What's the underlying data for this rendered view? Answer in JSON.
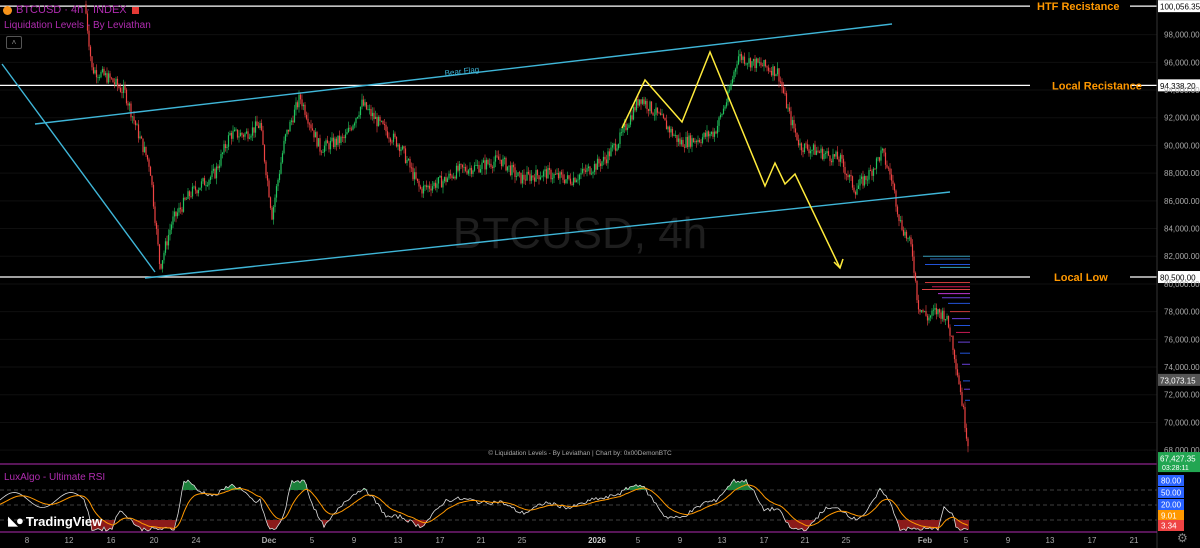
{
  "header": {
    "symbol": "BTCUSD · 4h · INDEX",
    "indicator": "Liquidation Levels - By Leviathan"
  },
  "watermark": "BTCUSD, 4h",
  "footer_credit": "© Liquidation Levels - By Leviathan | Chart by: 0x00DemonBTC",
  "rsi_panel": {
    "title": "LuxAlgo - Ultimate RSI",
    "levels": [
      80,
      50,
      20
    ]
  },
  "branding": "TradingView",
  "colors": {
    "up": "#22c55e",
    "down": "#ef4444",
    "channel": "#3fb6d8",
    "projection": "#ffeb3b",
    "levels": "#ffffff",
    "level_labels": "#ff9800",
    "accent": "#b02cb0"
  },
  "chart_data": {
    "type": "candlestick",
    "x_ticks": [
      "8",
      "12",
      "16",
      "20",
      "24",
      "Dec",
      "5",
      "9",
      "13",
      "17",
      "21",
      "25",
      "2026",
      "5",
      "9",
      "13",
      "17",
      "21",
      "25",
      "Feb",
      "5",
      "9",
      "13",
      "17",
      "21"
    ],
    "y_ticks": [
      68000,
      70000,
      72000,
      74000,
      76000,
      78000,
      80000,
      82000,
      84000,
      86000,
      88000,
      90000,
      92000,
      94000,
      96000,
      98000
    ],
    "ylim": [
      67000,
      100500
    ],
    "horizontal_levels": [
      {
        "label": "HTF Recistance",
        "value": 100056.35,
        "value_label": "100,056.35"
      },
      {
        "label": "Local Recistance",
        "value": 94338.2,
        "value_label": "94,338.20"
      },
      {
        "label": "Local Low",
        "value": 80500,
        "value_label": "80,500.00"
      }
    ],
    "price_labels": [
      {
        "value": 73073.15,
        "text": "73,073.15"
      },
      {
        "value": 67427.35,
        "text": "67,427.35",
        "sub": "03:28:11"
      }
    ],
    "annotations": [
      {
        "text": "Bear Flag"
      }
    ],
    "rsi_labels": [
      {
        "text": "80.00",
        "color": "#2962ff"
      },
      {
        "text": "50.00",
        "color": "#2962ff"
      },
      {
        "text": "20.00",
        "color": "#2962ff"
      },
      {
        "text": "9.01",
        "color": "#ff9800"
      },
      {
        "text": "3.34",
        "color": "#ef4444"
      }
    ]
  }
}
